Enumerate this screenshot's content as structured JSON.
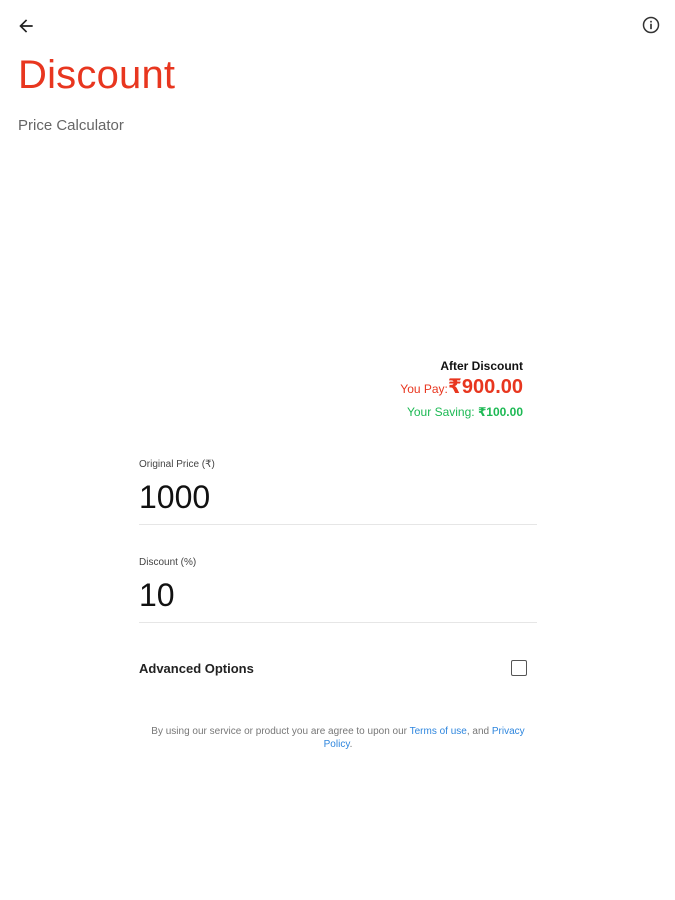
{
  "header": {
    "title": "Discount",
    "subtitle": "Price Calculator",
    "back_icon": "back-arrow-icon",
    "info_icon": "info-icon"
  },
  "result": {
    "heading": "After Discount",
    "pay_label": "You Pay:",
    "pay_amount": "₹900.00",
    "saving_label": "Your Saving:",
    "saving_amount": "₹100.00"
  },
  "fields": {
    "original_price": {
      "label": "Original Price (₹)",
      "value": "1000"
    },
    "discount": {
      "label": "Discount (%)",
      "value": "10"
    }
  },
  "advanced": {
    "label": "Advanced Options",
    "checked": false
  },
  "terms": {
    "prefix": "By using our service or product you are agree to upon our ",
    "terms_link": "Terms of use",
    "middle": ", and ",
    "privacy_link": "Privacy Policy",
    "suffix": "."
  },
  "colors": {
    "accent": "#e8361f",
    "saving": "#1db954",
    "link": "#2e86de"
  }
}
